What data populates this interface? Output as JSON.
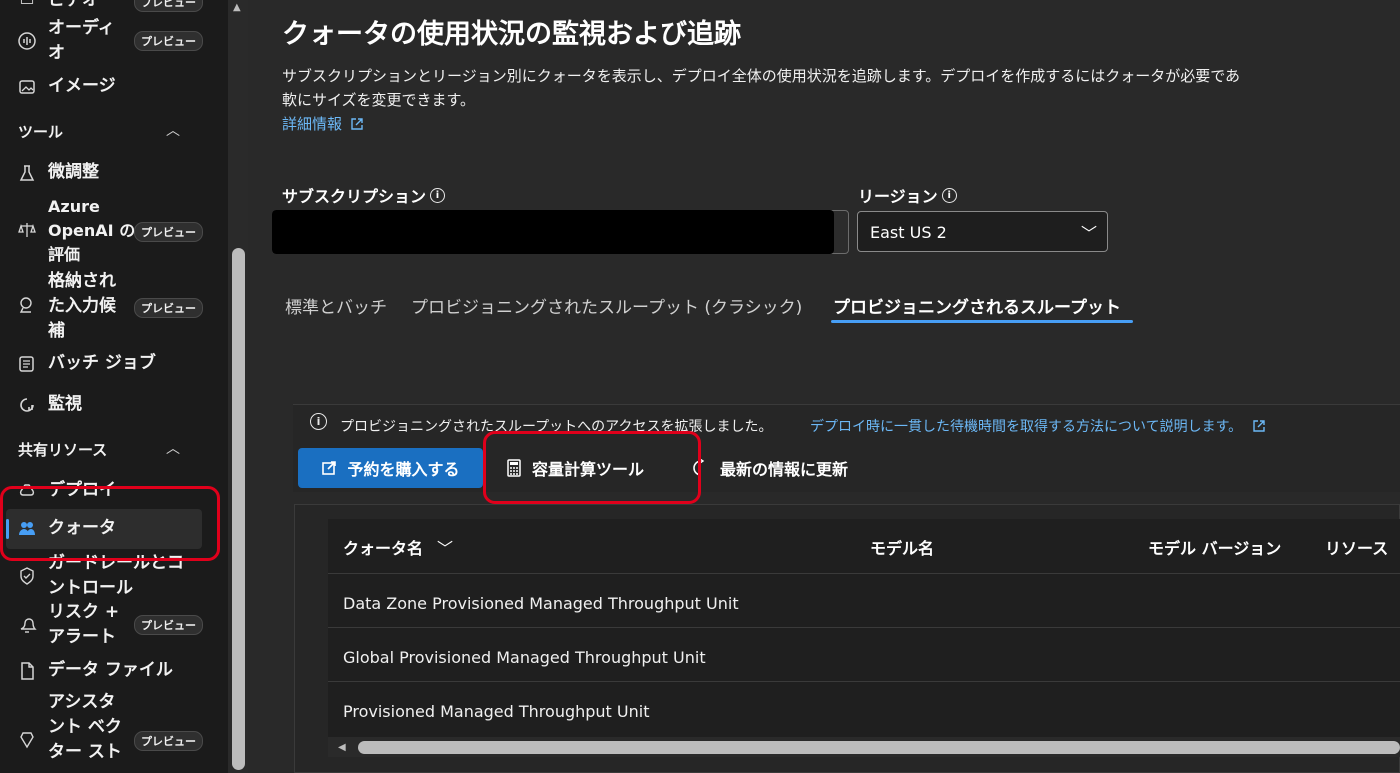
{
  "sidebar": {
    "top_item": {
      "label": "ビデオ",
      "badge": "プレビュー"
    },
    "items_top": [
      {
        "label": "オーディ\nオ",
        "badge": "プレビュー",
        "icon": "audio-icon"
      },
      {
        "label": "イメージ",
        "badge": "",
        "icon": "image-icon"
      }
    ],
    "tools_section": "ツール",
    "tools_items": [
      {
        "label": "微調整",
        "badge": "",
        "icon": "flask-icon"
      },
      {
        "label": "Azure\nOpenAI の\n評価",
        "badge": "プレビュー",
        "icon": "scale-icon"
      },
      {
        "label": "格納され\nた入力候\n補",
        "badge": "プレビュー",
        "icon": "stored-completions-icon"
      },
      {
        "label": "バッチ ジョブ",
        "badge": "",
        "icon": "batch-icon"
      },
      {
        "label": "監視",
        "badge": "",
        "icon": "monitor-icon"
      }
    ],
    "shared_section": "共有リソース",
    "shared_items": [
      {
        "label": "デプロイ",
        "badge": "",
        "icon": "deploy-icon"
      },
      {
        "label": "クォータ",
        "badge": "",
        "icon": "quota-icon"
      },
      {
        "label": "ガードレールとコ\nントロール",
        "badge": "",
        "icon": "shield-icon"
      },
      {
        "label": "リスク +\nアラート",
        "badge": "プレビュー",
        "icon": "alert-icon"
      },
      {
        "label": "データ ファイル",
        "badge": "",
        "icon": "file-icon"
      },
      {
        "label": "アシスタ\nント ベク\nター スト",
        "badge": "プレビュー",
        "icon": "vector-store-icon"
      }
    ]
  },
  "main": {
    "title": "クォータの使用状況の監視および追跡",
    "description_line1": "サブスクリプションとリージョン別にクォータを表示し、デプロイ全体の使用状況を追跡します。デプロイを作成するにはクォータが必要であ",
    "description_line2": "軟にサイズを変更できます。",
    "learn_more": "詳細情報",
    "subscription_label": "サブスクリプション",
    "region_label": "リージョン",
    "region_value": "East US 2",
    "tabs": [
      {
        "label": "標準とバッチ"
      },
      {
        "label": "プロビジョニングされたスループット (クラシック)"
      },
      {
        "label": "プロビジョニングされるスループット"
      }
    ],
    "banner_text": "プロビジョニングされたスループットへのアクセスを拡張しました。",
    "banner_link": "デプロイ時に一貫した待機時間を取得する方法について説明します。",
    "toolbar": {
      "buy": "予約を購入する",
      "calc": "容量計算ツール",
      "refresh": "最新の情報に更新"
    },
    "table": {
      "columns": [
        "クォータ名",
        "モデル名",
        "モデル バージョン",
        "リソース"
      ],
      "rows": [
        "Data Zone Provisioned Managed Throughput Unit",
        "Global Provisioned Managed Throughput Unit",
        "Provisioned Managed Throughput Unit"
      ]
    }
  },
  "colors": {
    "accent": "#479ef5",
    "primary_button": "#1a6fc1",
    "highlight": "#e0001b",
    "link": "#6cb8f6"
  }
}
